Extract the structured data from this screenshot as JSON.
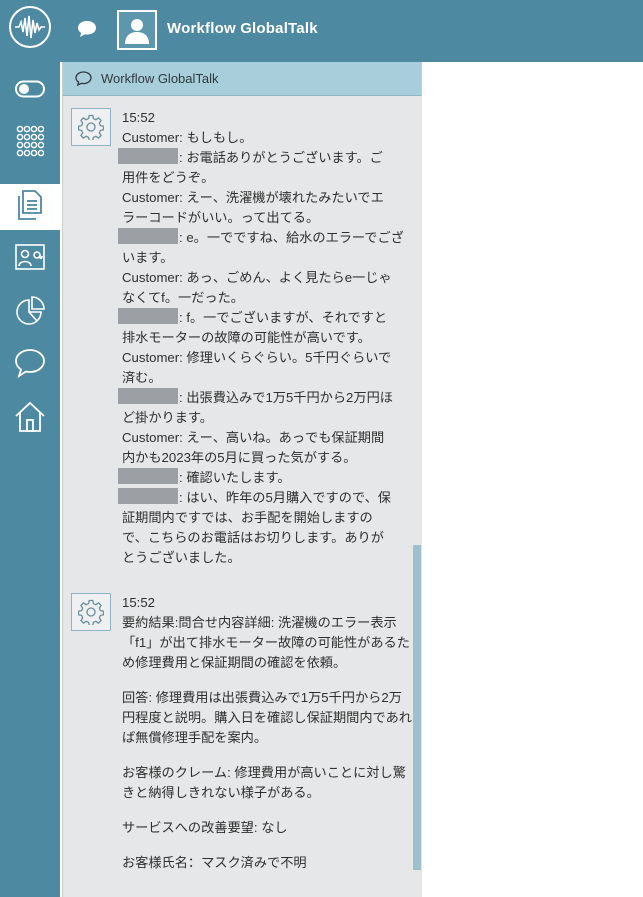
{
  "app": {
    "title": "Workflow GlobalTalk"
  },
  "panel": {
    "title": "Workflow GlobalTalk"
  },
  "sidebar": {
    "items": [
      {
        "icon": "toggle-icon",
        "active": false
      },
      {
        "icon": "dialpad-icon",
        "active": false
      },
      {
        "icon": "documents-icon",
        "active": true
      },
      {
        "icon": "contact-card-icon",
        "active": false
      },
      {
        "icon": "pie-chart-icon",
        "active": false
      },
      {
        "icon": "chat-bubble-icon",
        "active": false
      },
      {
        "icon": "home-icon",
        "active": false
      }
    ]
  },
  "messages": [
    {
      "time": "15:52",
      "lines": [
        {
          "redacted": false,
          "text": "Customer: もしもし。"
        },
        {
          "redacted": true,
          "text": ": お電話ありがとうございます。ご"
        },
        {
          "redacted": false,
          "text": "用件をどうぞ。"
        },
        {
          "redacted": false,
          "text": "Customer: えー、洗濯機が壊れたみたいでエ"
        },
        {
          "redacted": false,
          "text": "ラーコードがいい。って出てる。"
        },
        {
          "redacted": true,
          "text": ": e。一でですね、給水のエラーでござ"
        },
        {
          "redacted": false,
          "text": "います。"
        },
        {
          "redacted": false,
          "text": "Customer: あっ、ごめん、よく見たらe一じゃ"
        },
        {
          "redacted": false,
          "text": "なくてf。一だった。"
        },
        {
          "redacted": true,
          "text": ": f。一でございますが、それですと"
        },
        {
          "redacted": false,
          "text": "排水モーターの故障の可能性が高いです。"
        },
        {
          "redacted": false,
          "text": "Customer: 修理いくらぐらい。5千円ぐらいで"
        },
        {
          "redacted": false,
          "text": "済む。"
        },
        {
          "redacted": true,
          "text": ": 出張費込みで1万5千円から2万円ほ"
        },
        {
          "redacted": false,
          "text": "ど掛かります。"
        },
        {
          "redacted": false,
          "text": "Customer: えー、高いね。あっでも保証期間"
        },
        {
          "redacted": false,
          "text": "内かも2023年の5月に買った気がする。"
        },
        {
          "redacted": true,
          "text": ": 確認いたします。"
        },
        {
          "redacted": true,
          "text": ": はい、昨年の5月購入ですので、保"
        },
        {
          "redacted": false,
          "text": "証期間内ですでは、お手配を開始しますの"
        },
        {
          "redacted": false,
          "text": "で、こちらのお電話はお切りします。ありが"
        },
        {
          "redacted": false,
          "text": "とうございました。"
        }
      ]
    },
    {
      "time": "15:52",
      "paragraphs": [
        "要約結果:問合せ内容詳細: 洗濯機のエラー表示「f1」が出て排水モーター故障の可能性があるため修理費用と保証期間の確認を依頼。",
        "回答: 修理費用は出張費込みで1万5千円から2万円程度と説明。購入日を確認し保証期間内であれば無償修理手配を案内。",
        "お客様のクレーム: 修理費用が高いことに対し驚きと納得しきれない様子がある。",
        "サービスへの改善要望: なし",
        "お客様氏名：マスク済みで不明"
      ]
    }
  ]
}
